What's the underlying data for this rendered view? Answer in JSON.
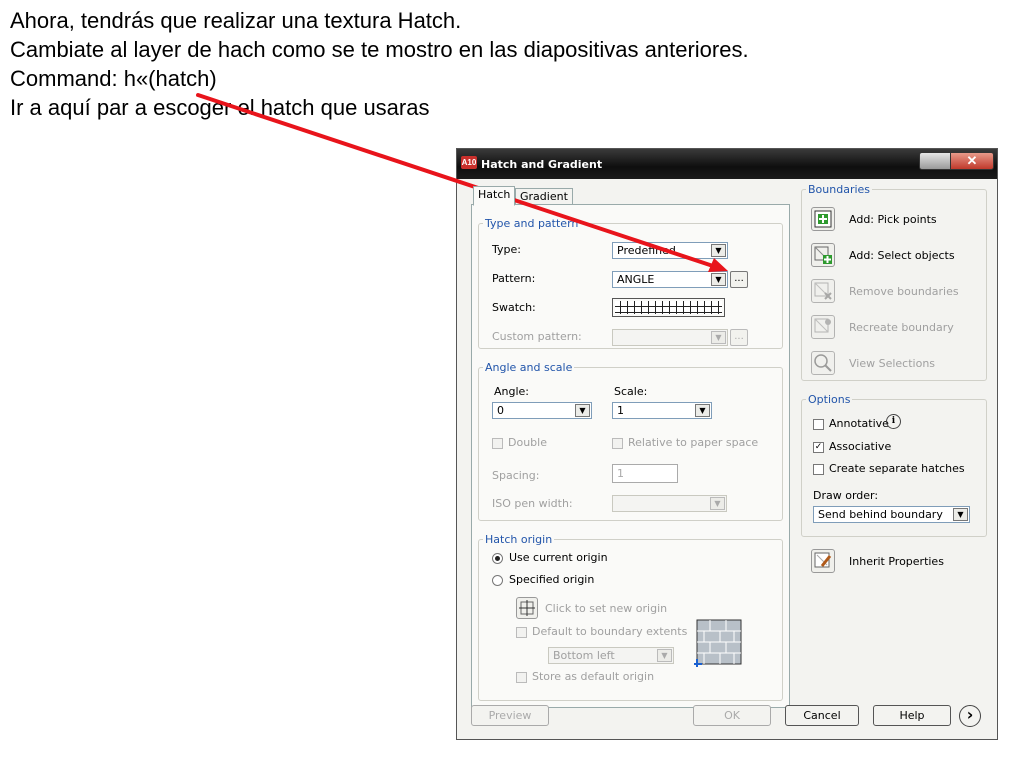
{
  "slide": {
    "line1": "Ahora, tendrás que realizar una textura Hatch.",
    "line2": "Cambiate al layer de hach como se te mostro en las diapositivas anteriores.",
    "line3": "Command: h«(hatch)",
    "line4": "Ir a aquí par a escoger el hatch que usaras"
  },
  "dialog": {
    "title": "Hatch and Gradient",
    "logo_text": "A10",
    "close_label": "✕",
    "tabs": [
      {
        "label": "Hatch",
        "active": true
      },
      {
        "label": "Gradient",
        "active": false
      }
    ],
    "type_pattern": {
      "legend": "Type and pattern",
      "type_label": "Type:",
      "type_value": "Predefined",
      "pattern_label": "Pattern:",
      "pattern_value": "ANGLE",
      "pattern_browse": "...",
      "swatch_label": "Swatch:",
      "custom_label": "Custom pattern:",
      "custom_value": "",
      "custom_browse": "..."
    },
    "angle_scale": {
      "legend": "Angle and scale",
      "angle_label": "Angle:",
      "angle_value": "0",
      "scale_label": "Scale:",
      "scale_value": "1",
      "double_label": "Double",
      "relative_label": "Relative to paper space",
      "spacing_label": "Spacing:",
      "spacing_value": "1",
      "iso_label": "ISO pen width:",
      "iso_value": ""
    },
    "hatch_origin": {
      "legend": "Hatch origin",
      "use_current_label": "Use current origin",
      "use_current_selected": true,
      "specified_label": "Specified origin",
      "click_set_label": "Click to set new origin",
      "default_extents_label": "Default to boundary extents",
      "position_value": "Bottom left",
      "store_default_label": "Store as default origin"
    },
    "boundaries": {
      "legend": "Boundaries",
      "add_pick_label": "Add: Pick points",
      "add_select_label": "Add: Select objects",
      "remove_label": "Remove boundaries",
      "recreate_label": "Recreate boundary",
      "view_label": "View Selections"
    },
    "options": {
      "legend": "Options",
      "annotative_label": "Annotative",
      "annotative_checked": false,
      "associative_label": "Associative",
      "associative_checked": true,
      "separate_label": "Create separate hatches",
      "separate_checked": false,
      "draw_order_label": "Draw order:",
      "draw_order_value": "Send behind boundary"
    },
    "inherit_label": "Inherit Properties",
    "footer": {
      "preview": "Preview",
      "ok": "OK",
      "cancel": "Cancel",
      "help": "Help",
      "more": "›"
    }
  },
  "colors": {
    "annotation_arrow": "#e8141b",
    "group_legend": "#2255aa"
  }
}
